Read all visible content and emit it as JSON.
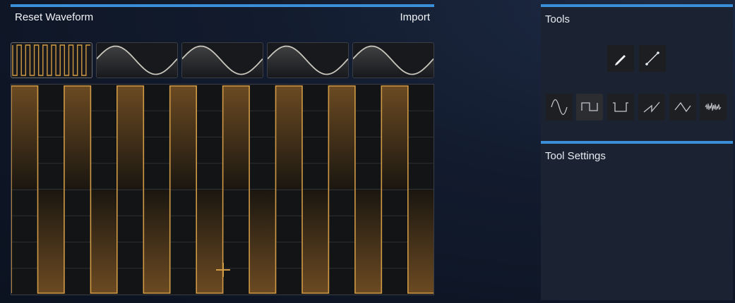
{
  "header": {
    "reset_label": "Reset Waveform",
    "import_label": "Import"
  },
  "thumbnails": [
    {
      "kind": "square",
      "selected": true
    },
    {
      "kind": "sine",
      "selected": false
    },
    {
      "kind": "sine",
      "selected": false
    },
    {
      "kind": "sine",
      "selected": false
    },
    {
      "kind": "sine",
      "selected": false
    }
  ],
  "editor": {
    "waveform": "square",
    "cycles": 8
  },
  "tools": {
    "title": "Tools",
    "draw_tools": [
      {
        "name": "pencil-icon"
      },
      {
        "name": "line-icon"
      }
    ],
    "shapes": [
      {
        "name": "sine-shape-icon",
        "active": false
      },
      {
        "name": "square-shape-icon",
        "active": true
      },
      {
        "name": "pulse-shape-icon",
        "active": false
      },
      {
        "name": "saw-shape-icon",
        "active": false
      },
      {
        "name": "triangle-shape-icon",
        "active": false
      },
      {
        "name": "noise-shape-icon",
        "active": false
      }
    ]
  },
  "tool_settings": {
    "title": "Tool Settings"
  },
  "colors": {
    "accent": "#3a8fd8",
    "wave": "#d19a45",
    "wave_fill_top": "#6b4a22",
    "grid": "#2c2e33",
    "thumb_wave": "#c9c6bd"
  }
}
